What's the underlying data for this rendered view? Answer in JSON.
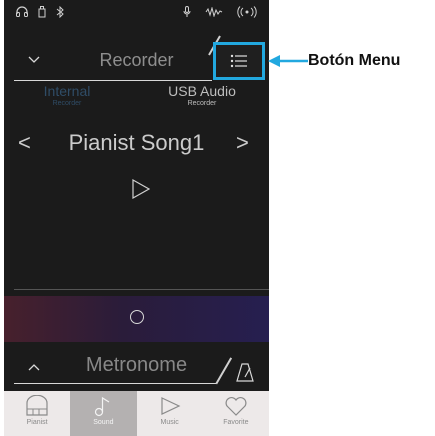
{
  "header": {
    "title": "Recorder",
    "menu_button_icon": "menu-list-icon"
  },
  "tabs": [
    {
      "label": "Internal",
      "sublabel": "Recorder",
      "active": true
    },
    {
      "label": "USB Audio",
      "sublabel": "Recorder",
      "active": false
    }
  ],
  "song": {
    "name": "Pianist Song1",
    "prev_glyph": "<",
    "next_glyph": ">"
  },
  "metronome": {
    "label": "Metronome"
  },
  "bottom_nav": [
    {
      "label": "Pianist",
      "icon": "piano-icon",
      "active": false
    },
    {
      "label": "Sound",
      "icon": "music-note-icon",
      "active": true
    },
    {
      "label": "Music",
      "icon": "play-icon",
      "active": false
    },
    {
      "label": "Favorite",
      "icon": "heart-icon",
      "active": false
    }
  ],
  "callout": {
    "text": "Botón Menu"
  },
  "colors": {
    "highlight": "#22a8df",
    "background": "#1b1b1b",
    "active_tab": "#2f4c66"
  }
}
